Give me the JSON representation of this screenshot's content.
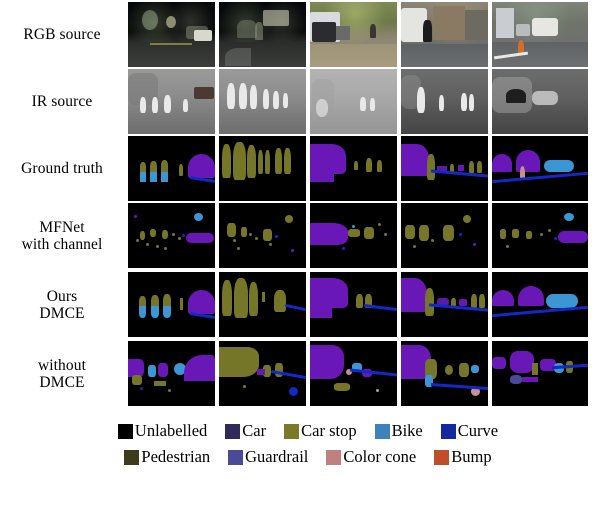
{
  "figure": {
    "rows": [
      {
        "id": "rgb-source",
        "label_lines": [
          "RGB source"
        ]
      },
      {
        "id": "ir-source",
        "label_lines": [
          "IR source"
        ]
      },
      {
        "id": "ground-truth",
        "label_lines": [
          "Ground truth"
        ]
      },
      {
        "id": "mfnet-with-channel",
        "label_lines": [
          "MFNet",
          "with channel"
        ]
      },
      {
        "id": "ours-dmce",
        "label_lines": [
          "Ours",
          "DMCE"
        ]
      },
      {
        "id": "without-dmce",
        "label_lines": [
          "without",
          "DMCE"
        ]
      }
    ],
    "column_count": 5
  },
  "legend": {
    "rows": [
      [
        {
          "label": "Unlabelled",
          "color": "#000000"
        },
        {
          "label": "Car",
          "color": "#2e2a5a"
        },
        {
          "label": "Car stop",
          "color": "#7a7a28"
        },
        {
          "label": "Bike",
          "color": "#3d82b8"
        },
        {
          "label": "Curve",
          "color": "#1428a0"
        }
      ],
      [
        {
          "label": "Pedestrian",
          "color": "#3c3c1a"
        },
        {
          "label": "Guardrail",
          "color": "#4a4a96"
        },
        {
          "label": "Color cone",
          "color": "#c08080"
        },
        {
          "label": "Bump",
          "color": "#c04f28"
        }
      ]
    ]
  }
}
